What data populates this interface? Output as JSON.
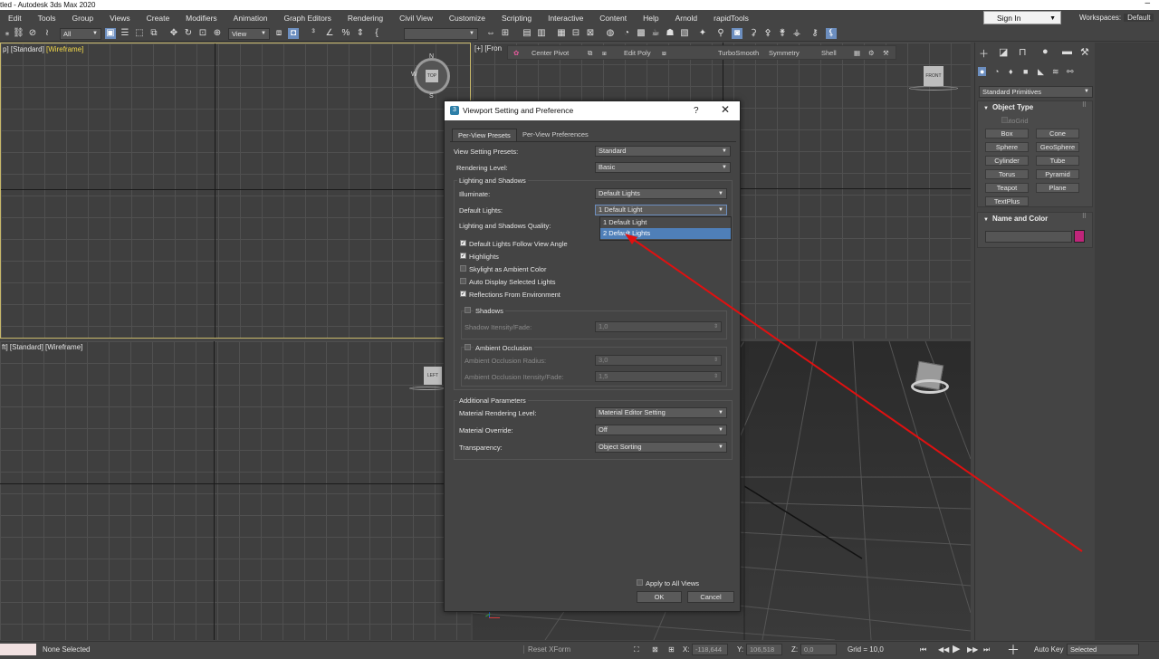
{
  "window": {
    "title": "tled - Autodesk 3ds Max 2020",
    "minimize_glyph": "‒"
  },
  "menu": {
    "items": [
      "Edit",
      "Tools",
      "Group",
      "Views",
      "Create",
      "Modifiers",
      "Animation",
      "Graph Editors",
      "Rendering",
      "Civil View",
      "Customize",
      "Scripting",
      "Interactive",
      "Content",
      "Help",
      "Arnold",
      "rapidTools"
    ],
    "sign_in": "Sign In",
    "workspaces_label": "Workspaces:",
    "workspaces_value": "Default"
  },
  "toolbar": {
    "selection_filter": "All",
    "reference_coord": "View"
  },
  "viewports": {
    "top_label_prefix": "p] [Standard] ",
    "top_label_mode": "[Wireframe]",
    "left_label": "ft] [Standard] [Wireframe]",
    "front_label": "[+] [Fron",
    "top_gizmo": "TOP",
    "left_gizmo": "LEFT",
    "front_gizmo": "FRONT",
    "compass_n": "N",
    "compass_w": "W",
    "compass_s": "S"
  },
  "front_toolbar": {
    "center_pivot": "Center Pivot",
    "edit_poly": "Edit Poly",
    "turbosmooth": "TurboSmooth",
    "symmetry": "Symmetry",
    "shell": "Shell"
  },
  "command_panel": {
    "category": "Standard Primitives",
    "object_type_title": "Object Type",
    "autogrid": "AutoGrid",
    "buttons": [
      "Box",
      "Cone",
      "Sphere",
      "GeoSphere",
      "Cylinder",
      "Tube",
      "Torus",
      "Pyramid",
      "Teapot",
      "Plane",
      "TextPlus"
    ],
    "name_color_title": "Name and Color",
    "color": "#c0257a"
  },
  "dialog": {
    "title": "Viewport Setting and Preference",
    "help": "?",
    "close": "✕",
    "tab_presets": "Per-View Presets",
    "tab_preferences": "Per-View Preferences",
    "view_setting_presets_label": "View Setting Presets:",
    "view_setting_presets_value": "Standard",
    "rendering_level_label": "Rendering Level:",
    "rendering_level_value": "Basic",
    "lighting_shadows_group": "Lighting and Shadows",
    "illuminate_label": "Illuminate:",
    "illuminate_value": "Default Lights",
    "default_lights_label": "Default Lights:",
    "default_lights_value": "1 Default Light",
    "quality_label": "Lighting and Shadows Quality:",
    "dropdown_options": [
      "1 Default Light",
      "2 Default Lights"
    ],
    "checkboxes": [
      {
        "label": "Default Lights Follow View Angle",
        "checked": true
      },
      {
        "label": "Highlights",
        "checked": true
      },
      {
        "label": "Skylight as Ambient Color",
        "checked": false
      },
      {
        "label": "Auto Display Selected Lights",
        "checked": false
      },
      {
        "label": "Reflections From Environment",
        "checked": true
      }
    ],
    "shadows_label": "Shadows",
    "shadow_intensity_label": "Shadow Itensity/Fade:",
    "shadow_intensity_value": "1,0",
    "ambient_occlusion_label": "Ambient Occlusion",
    "ao_radius_label": "Ambient Occlusion Radius:",
    "ao_radius_value": "3,0",
    "ao_intensity_label": "Ambient Occlusion Itensity/Fade:",
    "ao_intensity_value": "1,5",
    "additional_group": "Additional Parameters",
    "material_level_label": "Material Rendering Level:",
    "material_level_value": "Material Editor Setting",
    "material_override_label": "Material Override:",
    "material_override_value": "Off",
    "transparency_label": "Transparency:",
    "transparency_value": "Object Sorting",
    "apply_all_label": "Apply to All Views",
    "ok": "OK",
    "cancel": "Cancel"
  },
  "status": {
    "selection": "None Selected",
    "reset_xform": "Reset XForm",
    "x_label": "X:",
    "x_value": "-118,644",
    "y_label": "Y:",
    "y_value": "106,518",
    "z_label": "Z:",
    "z_value": "0,0",
    "grid": "Grid = 10,0",
    "auto_key": "Auto Key",
    "selected": "Selected"
  },
  "annotation": {
    "arrow_color": "#e01010"
  }
}
